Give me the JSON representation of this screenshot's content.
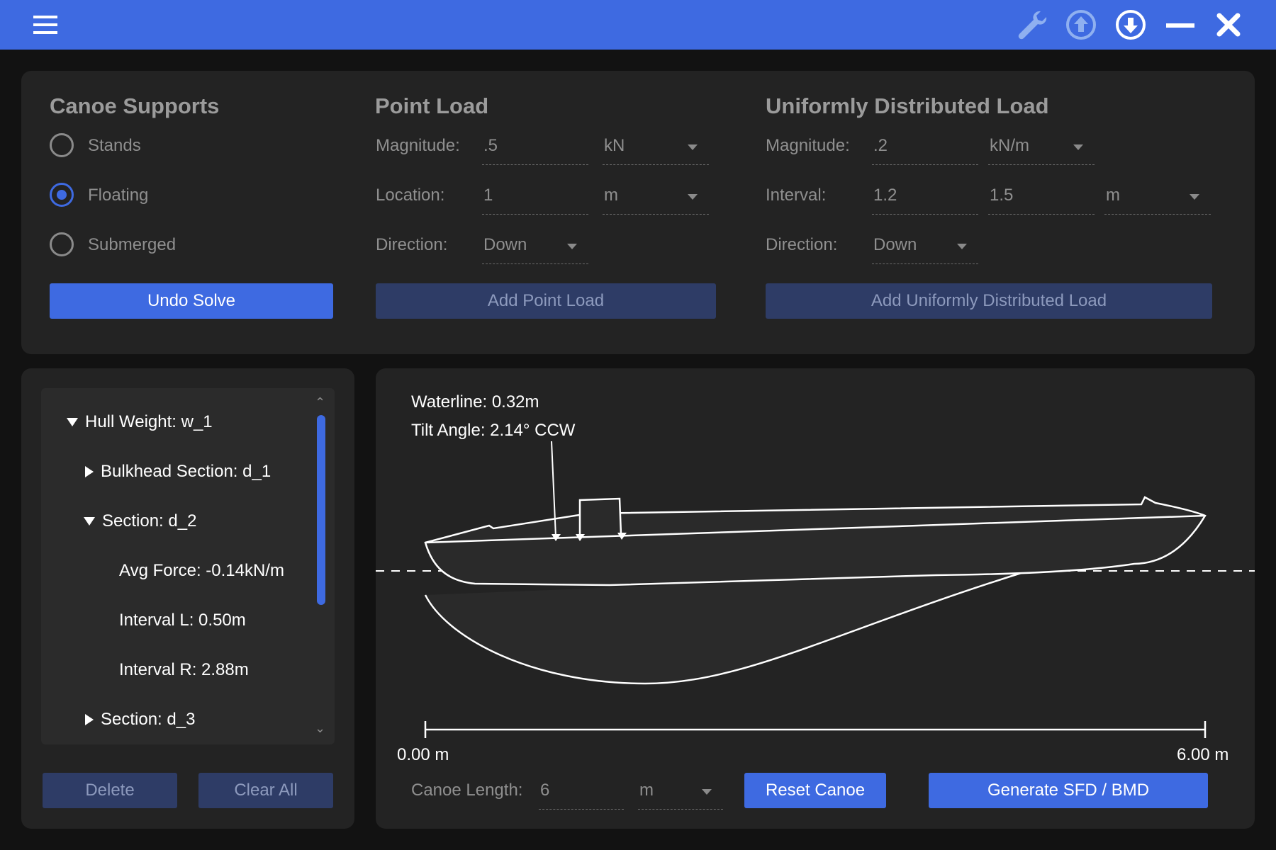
{
  "toolbar": {
    "menu_icon": "hamburger-menu-icon",
    "icons": [
      "wrench-icon",
      "upload-circle-icon",
      "download-circle-icon",
      "minimize-icon",
      "close-icon"
    ]
  },
  "supports": {
    "title": "Canoe Supports",
    "options": [
      {
        "label": "Stands",
        "checked": false
      },
      {
        "label": "Floating",
        "checked": true
      },
      {
        "label": "Submerged",
        "checked": false
      }
    ],
    "undo_label": "Undo Solve"
  },
  "point_load": {
    "title": "Point Load",
    "magnitude_label": "Magnitude:",
    "magnitude_value": ".5",
    "magnitude_unit": "kN",
    "location_label": "Location:",
    "location_value": "1",
    "location_unit": "m",
    "direction_label": "Direction:",
    "direction_value": "Down",
    "add_label": "Add Point Load"
  },
  "udl": {
    "title": "Uniformly Distributed Load",
    "magnitude_label": "Magnitude:",
    "magnitude_value": ".2",
    "magnitude_unit": "kN/m",
    "interval_label": "Interval:",
    "interval_start": "1.2",
    "interval_end": "1.5",
    "interval_unit": "m",
    "direction_label": "Direction:",
    "direction_value": "Down",
    "add_label": "Add Uniformly Distributed Load"
  },
  "tree": {
    "items": [
      "Hull Weight: w_1",
      "Bulkhead Section: d_1",
      "Section: d_2",
      "Avg Force: -0.14kN/m",
      "Interval L: 0.50m",
      "Interval R: 2.88m",
      "Section: d_3"
    ],
    "delete_label": "Delete",
    "clear_label": "Clear All"
  },
  "simulation": {
    "waterline": "Waterline: 0.32m",
    "tilt": "Tilt Angle: 2.14° CCW",
    "scale_start": "0.00 m",
    "scale_end": "6.00 m",
    "length_label": "Canoe Length:",
    "length_value": "6",
    "length_unit": "m",
    "reset_label": "Reset Canoe",
    "generate_label": "Generate SFD / BMD"
  },
  "colors": {
    "accent": "#3e6ae1",
    "panel": "#232323",
    "background": "#121212"
  }
}
